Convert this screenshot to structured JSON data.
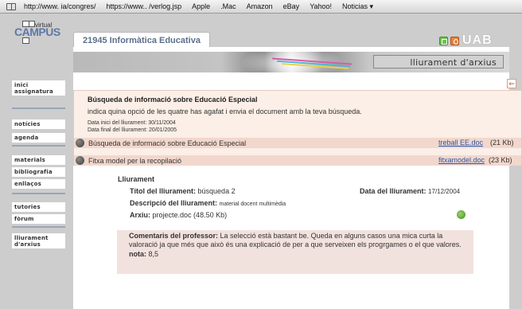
{
  "bookmarks": [
    "http://www. ia/congres/",
    "https://www.. /verlog.jsp",
    "Apple",
    ".Mac",
    "Amazon",
    "eBay",
    "Yahoo!",
    "Noticias ▾"
  ],
  "logo": {
    "virtual": "virtual",
    "campus": "CAMPUS"
  },
  "nav": {
    "inici": "inici assignatura",
    "noticies": "notícies",
    "agenda": "agenda",
    "materials": "materials",
    "bibliografia": "bibliografia",
    "enllacos": "enllaços",
    "tutories": "tutories",
    "forum": "fòrum",
    "lliurament": "lliurament d'arxius"
  },
  "header": {
    "course": "21945 Informàtica Educativa",
    "brand": "UAB",
    "section_title": "lliurament d'arxius"
  },
  "icons": {
    "back": "back-arrow-icon",
    "globe": "globe-icon",
    "download": "download-icon"
  },
  "popup": {
    "title": "Búsqueda de informació sobre Educació Especial",
    "instruction": "indica quina opció de les quatre has agafat i envia el document amb la teva búsqueda.",
    "start_date": "Data inici del lliurament: 30/11/2004",
    "end_date": "Data final del lliurament: 20/01/2005",
    "docs": [
      {
        "label": "Búsqueda de informació sobre Educació Especial",
        "file": "treball EE.doc",
        "size": "(21 Kb)"
      },
      {
        "label": "Fitxa model per la recopilació",
        "file": "fitxamodel.doc",
        "size": "(23 Kb)"
      }
    ]
  },
  "submission": {
    "heading": "Lliurament",
    "title_label": "Títol del lliurament:",
    "title_value": "búsqueda 2",
    "date_label": "Data del lliurament:",
    "date_value": "17/12/2004",
    "desc_label": "Descripció del lliurament:",
    "desc_value": "material docent multimèdia",
    "file_label": "Arxiu:",
    "file_value": "projecte.doc (48.50 Kb)"
  },
  "comment": {
    "label": "Comentaris del professor:",
    "text": "La selecció està bastant be. Queda en alguns casos una mica curta la valoració ja que més que això és una explicació de per a que serveixen els progrgames o el que valores.",
    "grade_label": "nota:",
    "grade_value": "8,5"
  },
  "colors": {
    "accent": "#5a6f8d",
    "link": "#2e55a8",
    "popup_bg": "#fbefe7",
    "row_bg": "#f2d7cc"
  }
}
